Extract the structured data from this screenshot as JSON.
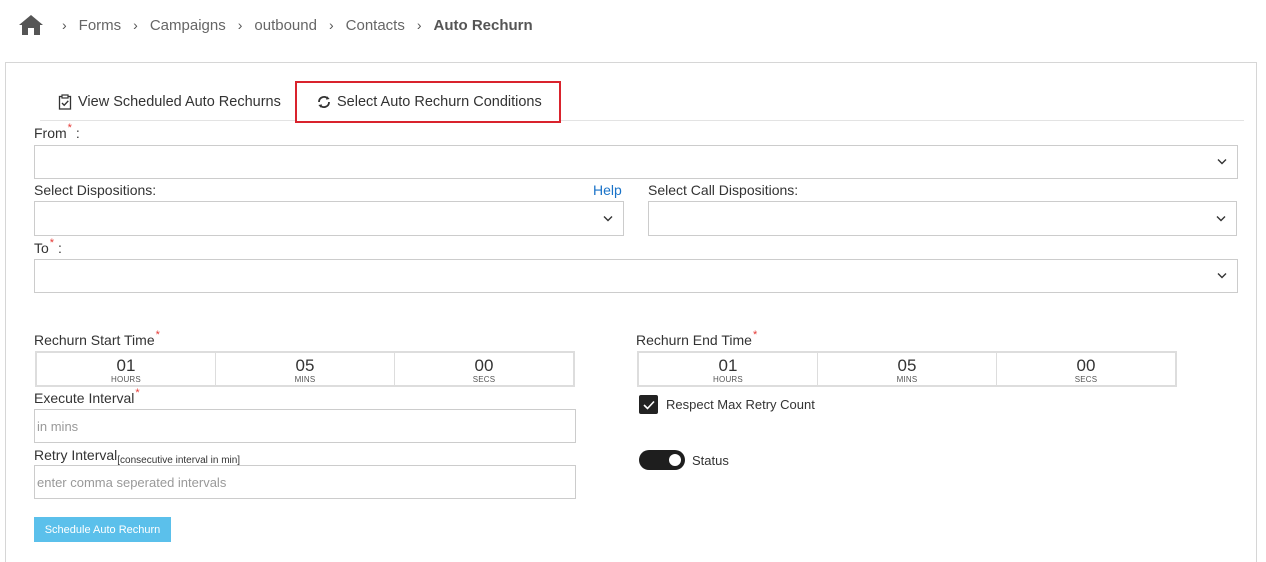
{
  "breadcrumb": {
    "items": [
      "Forms",
      "Campaigns",
      "outbound",
      "Contacts"
    ],
    "current": "Auto Rechurn"
  },
  "tabs": {
    "view_scheduled": "View Scheduled Auto Rechurns",
    "select_conditions": "Select Auto Rechurn Conditions"
  },
  "form": {
    "from_label": "From",
    "from_suffix": " :",
    "select_dispositions_label": "Select Dispositions:",
    "help_link": "Help",
    "select_call_dispositions_label": "Select Call Dispositions:",
    "to_label": "To",
    "to_suffix": " :",
    "required_mark": "*",
    "start_time": {
      "label": "Rechurn Start Time",
      "hours": "01",
      "mins": "05",
      "secs": "00",
      "hours_unit": "HOURS",
      "mins_unit": "MINS",
      "secs_unit": "SECS"
    },
    "end_time": {
      "label": "Rechurn End Time",
      "hours": "01",
      "mins": "05",
      "secs": "00",
      "hours_unit": "HOURS",
      "mins_unit": "MINS",
      "secs_unit": "SECS"
    },
    "execute_interval": {
      "label": "Execute Interval",
      "placeholder": "in mins"
    },
    "retry_interval": {
      "label": "Retry Interval",
      "sub_label": "[consecutive interval in min]",
      "placeholder": "enter comma seperated intervals"
    },
    "respect_max_retry": {
      "label": "Respect Max Retry Count",
      "checked": true
    },
    "status": {
      "label": "Status",
      "on": true
    },
    "submit_label": "Schedule Auto Rechurn"
  },
  "colors": {
    "accent_button": "#5bc0eb",
    "highlight_border": "#d9232d",
    "help_link": "#1a73c8",
    "required": "#e53935"
  },
  "icons": {
    "home": "home-icon",
    "clipboard": "clipboard-check-icon",
    "refresh": "refresh-icon",
    "chevron": "chevron-down-icon",
    "check": "check-icon"
  }
}
